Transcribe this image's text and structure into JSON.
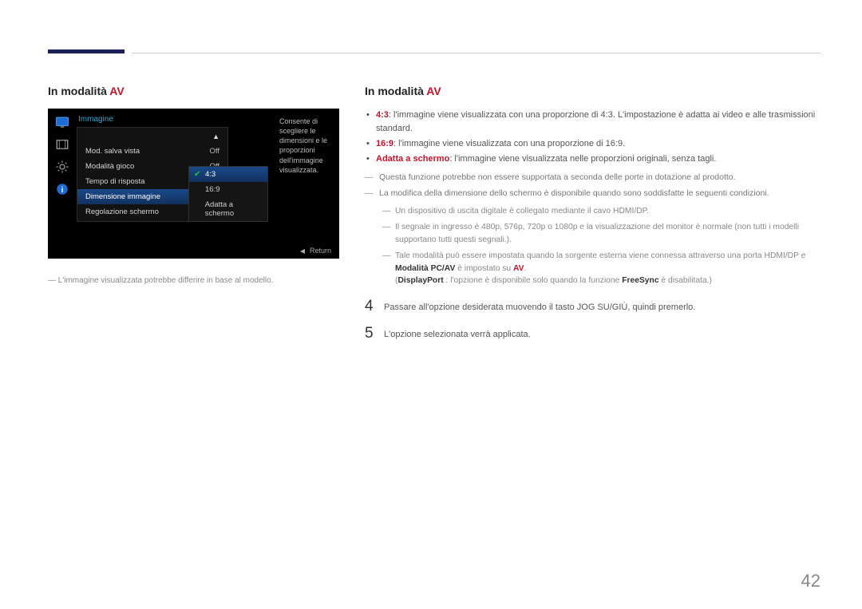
{
  "left": {
    "heading_prefix": "In modalità ",
    "heading_em": "AV",
    "osd": {
      "title": "Immagine",
      "rows": [
        {
          "label": "Mod. salva vista",
          "value": "Off"
        },
        {
          "label": "Modalità gioco",
          "value": "Off"
        },
        {
          "label": "Tempo di risposta",
          "value": ""
        },
        {
          "label": "Dimensione immagine",
          "value": "",
          "selected": true
        },
        {
          "label": "Regolazione schermo",
          "value": ""
        }
      ],
      "popup": [
        {
          "label": "4:3",
          "selected": true
        },
        {
          "label": "16:9",
          "selected": false
        },
        {
          "label": "Adatta a schermo",
          "selected": false
        }
      ],
      "help": "Consente di scegliere le dimensioni e le proporzioni dell'immagine visualizzata.",
      "return": "Return"
    },
    "note": "L'immagine visualizzata potrebbe differire in base al modello."
  },
  "right": {
    "heading_prefix": "In modalità ",
    "heading_em": "AV",
    "b1_em": "4:3",
    "b1_txt": ": l'immagine viene visualizzata con una proporzione di 4:3. L'impostazione è adatta ai video e alle trasmissioni standard.",
    "b2_em": "16:9",
    "b2_txt": ": l'immagine viene visualizzata con una proporzione di 16:9.",
    "b3_em": "Adatta a schermo",
    "b3_txt": ": l'immagine viene visualizzata nelle proporzioni originali, senza tagli.",
    "d1": "Questa funzione potrebbe non essere supportata a seconda delle porte in dotazione al prodotto.",
    "d2": "La modifica della dimensione dello schermo è disponibile quando sono soddisfatte le seguenti condizioni.",
    "n1": "Un dispositivo di uscita digitale è collegato mediante il cavo HDMI/DP.",
    "n2": "Il segnale in ingresso è 480p, 576p, 720p o 1080p e la visualizzazione del monitor è normale (non tutti i modelli supportano tutti questi segnali.).",
    "n3_a": "Tale modalità può essere impostata quando la sorgente esterna viene connessa attraverso una porta HDMI/DP e ",
    "n3_b": "Modalità PC/AV",
    "n3_c": " è impostato su ",
    "n3_d": "AV",
    "n3_e": ".",
    "n4_a": "(",
    "n4_b": "DisplayPort",
    "n4_c": " : l'opzione è disponibile solo quando la funzione ",
    "n4_d": "FreeSync",
    "n4_e": " è disabilitata.)",
    "step4_num": "4",
    "step4_txt": "Passare all'opzione desiderata muovendo il tasto JOG SU/GIÙ, quindi premerlo.",
    "step5_num": "5",
    "step5_txt": "L'opzione selezionata verrà applicata."
  },
  "page_number": "42"
}
